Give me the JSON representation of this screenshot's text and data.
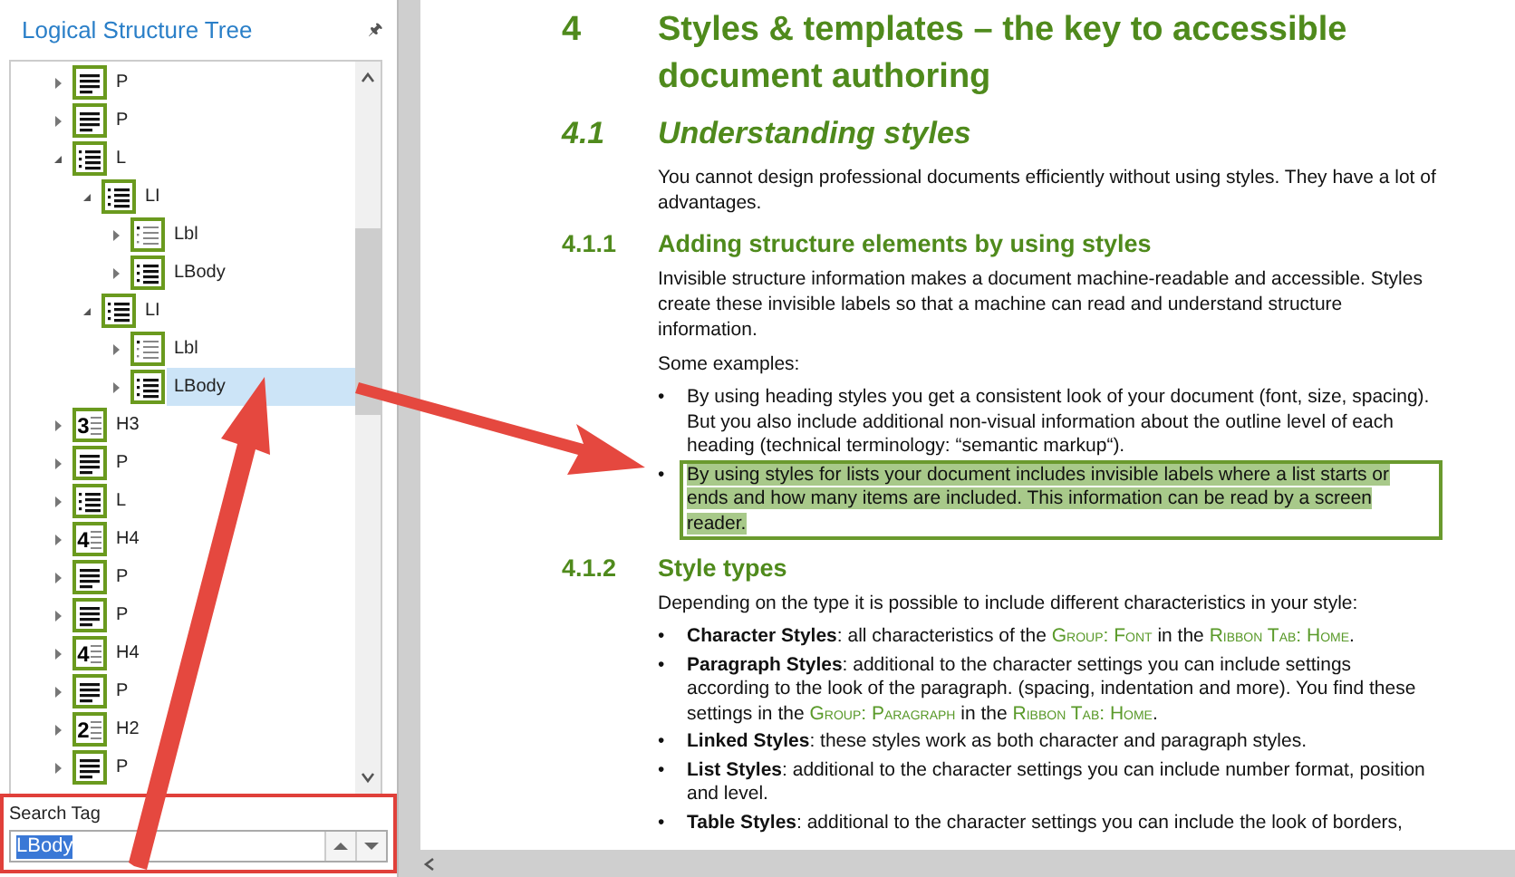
{
  "panel": {
    "title": "Logical Structure Tree",
    "pin": "🖈",
    "tree": [
      {
        "label": "P",
        "kind": "paragraph",
        "expanded": false,
        "selected": false
      },
      {
        "label": "P",
        "kind": "paragraph",
        "expanded": false,
        "selected": false
      },
      {
        "label": "L",
        "kind": "list",
        "expanded": true,
        "selected": false,
        "children": [
          {
            "label": "LI",
            "kind": "list",
            "expanded": true,
            "selected": false,
            "children": [
              {
                "label": "Lbl",
                "kind": "label",
                "expanded": false,
                "selected": false
              },
              {
                "label": "LBody",
                "kind": "list",
                "expanded": false,
                "selected": false
              }
            ]
          },
          {
            "label": "LI",
            "kind": "list",
            "expanded": true,
            "selected": false,
            "children": [
              {
                "label": "Lbl",
                "kind": "label",
                "expanded": false,
                "selected": false
              },
              {
                "label": "LBody",
                "kind": "list",
                "expanded": false,
                "selected": true
              }
            ]
          }
        ]
      },
      {
        "label": "H3",
        "kind": "heading",
        "number": "3",
        "expanded": false,
        "selected": false
      },
      {
        "label": "P",
        "kind": "paragraph",
        "expanded": false,
        "selected": false
      },
      {
        "label": "L",
        "kind": "list",
        "expanded": false,
        "selected": false
      },
      {
        "label": "H4",
        "kind": "heading",
        "number": "4",
        "expanded": false,
        "selected": false
      },
      {
        "label": "P",
        "kind": "paragraph",
        "expanded": false,
        "selected": false
      },
      {
        "label": "P",
        "kind": "paragraph",
        "expanded": false,
        "selected": false
      },
      {
        "label": "H4",
        "kind": "heading",
        "number": "4",
        "expanded": false,
        "selected": false
      },
      {
        "label": "P",
        "kind": "paragraph",
        "expanded": false,
        "selected": false
      },
      {
        "label": "H2",
        "kind": "heading",
        "number": "2",
        "expanded": false,
        "selected": false
      },
      {
        "label": "P",
        "kind": "paragraph",
        "expanded": false,
        "selected": false
      }
    ],
    "search": {
      "label": "Search Tag",
      "value": "LBody"
    }
  },
  "document": {
    "blocks": [
      {
        "kind": "h1",
        "number": "4",
        "title": "Styles & templates – the key to accessible document authoring"
      },
      {
        "kind": "h2",
        "number": "4.1",
        "title": "Understanding styles"
      },
      {
        "kind": "para",
        "text": "You cannot design professional documents efficiently without using styles. They have a lot of advantages."
      },
      {
        "kind": "h3",
        "number": "4.1.1",
        "title": "Adding structure elements by using styles"
      },
      {
        "kind": "para",
        "text": "Invisible structure information makes a document machine-readable and accessible. Styles create these invisible labels so that a machine can read and understand structure information."
      },
      {
        "kind": "para",
        "text": "Some examples:"
      },
      {
        "kind": "bullets",
        "items": [
          {
            "bullet": "•",
            "highlighted": false,
            "segments": [
              {
                "kind": "plain",
                "text": "By using heading styles you get a consistent look of your document (font, size, spacing). But you also include additional non-visual information about the outline level of each heading (technical terminology: “semantic markup“)."
              }
            ]
          },
          {
            "bullet": "•",
            "highlighted": true,
            "segments": [
              {
                "kind": "plain",
                "text": "By using styles for lists your document includes invisible labels where a list starts or ends and how many items are included. This information can be read by a screen reader."
              }
            ]
          }
        ]
      },
      {
        "kind": "h3",
        "number": "4.1.2",
        "title": "Style types"
      },
      {
        "kind": "para",
        "text": "Depending on the type it is possible to include different characteristics in your style:"
      },
      {
        "kind": "bullets",
        "items": [
          {
            "bullet": "•",
            "highlighted": false,
            "segments": [
              {
                "kind": "bold",
                "text": "Character Styles"
              },
              {
                "kind": "plain",
                "text": ": all characteristics of the "
              },
              {
                "kind": "ui",
                "text": "Group: Font"
              },
              {
                "kind": "plain",
                "text": " in the "
              },
              {
                "kind": "ui",
                "text": "Ribbon Tab: Home"
              },
              {
                "kind": "plain",
                "text": "."
              }
            ]
          },
          {
            "bullet": "•",
            "highlighted": false,
            "segments": [
              {
                "kind": "bold",
                "text": "Paragraph Styles"
              },
              {
                "kind": "plain",
                "text": ": additional to the character settings you can include settings according to the look of the paragraph. (spacing, indentation and more). You find these settings in the "
              },
              {
                "kind": "ui",
                "text": "Group: Paragraph"
              },
              {
                "kind": "plain",
                "text": " in the "
              },
              {
                "kind": "ui",
                "text": "Ribbon Tab: Home"
              },
              {
                "kind": "plain",
                "text": "."
              }
            ]
          },
          {
            "bullet": "•",
            "highlighted": false,
            "segments": [
              {
                "kind": "bold",
                "text": "Linked Styles"
              },
              {
                "kind": "plain",
                "text": ": these styles work as both character and paragraph styles."
              }
            ]
          },
          {
            "bullet": "•",
            "highlighted": false,
            "segments": [
              {
                "kind": "bold",
                "text": "List Styles"
              },
              {
                "kind": "plain",
                "text": ": additional to the character settings you can include number format, position and level."
              }
            ]
          },
          {
            "bullet": "•",
            "highlighted": false,
            "segments": [
              {
                "kind": "bold",
                "text": "Table Styles"
              },
              {
                "kind": "plain",
                "text": ": additional to the character settings you can include the look of borders,"
              }
            ]
          }
        ]
      }
    ]
  }
}
